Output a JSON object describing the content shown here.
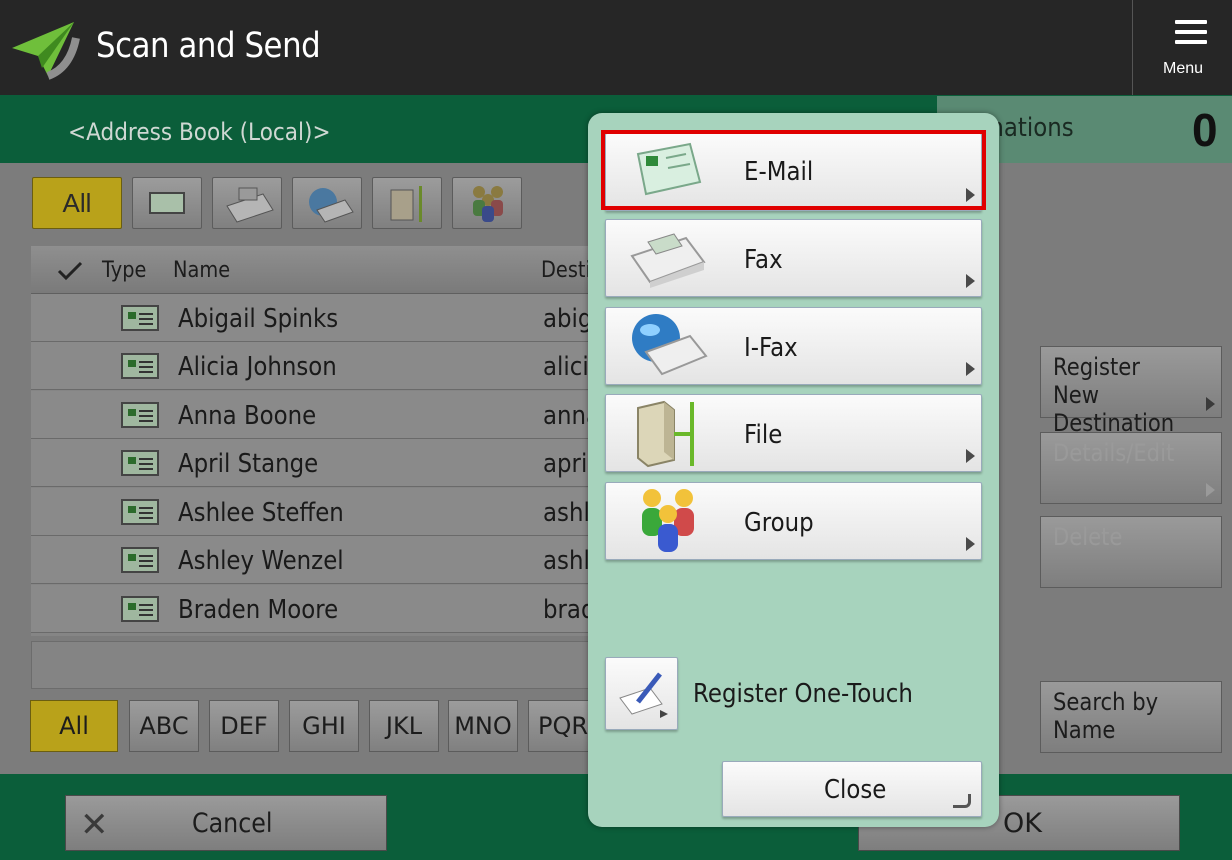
{
  "app": {
    "title": "Scan and Send",
    "menu_label": "Menu"
  },
  "address_book": {
    "title": "<Address Book (Local)>"
  },
  "destinations": {
    "label": "Destinations",
    "visible_label": "inations",
    "count": "0"
  },
  "filters": {
    "all_label": "All",
    "icons": [
      "email-icon",
      "fax-icon",
      "ifax-icon",
      "file-icon",
      "group-icon"
    ]
  },
  "table": {
    "headers": {
      "type": "Type",
      "name": "Name",
      "destination": "Desti"
    },
    "rows": [
      {
        "name": "Abigail Spinks",
        "destination": "abig"
      },
      {
        "name": "Alicia Johnson",
        "destination": "alicia"
      },
      {
        "name": "Anna Boone",
        "destination": "anna"
      },
      {
        "name": "April Stange",
        "destination": "april"
      },
      {
        "name": "Ashlee Steffen",
        "destination": "ashle"
      },
      {
        "name": "Ashley Wenzel",
        "destination": "ashle"
      },
      {
        "name": "Braden Moore",
        "destination": "brad"
      }
    ]
  },
  "alpha_tabs": [
    "All",
    "ABC",
    "DEF",
    "GHI",
    "JKL",
    "MNO",
    "PQR"
  ],
  "side_buttons": {
    "register_new_line1": "Register New",
    "register_new_line2": "Destination",
    "details_edit": "Details/Edit",
    "delete": "Delete",
    "search_line1": "Search by",
    "search_line2": "Name"
  },
  "footer": {
    "cancel_label": "Cancel",
    "ok_label": "OK"
  },
  "popup": {
    "items": [
      {
        "label": "E-Mail",
        "icon": "email-icon"
      },
      {
        "label": "Fax",
        "icon": "fax-icon"
      },
      {
        "label": "I-Fax",
        "icon": "ifax-icon"
      },
      {
        "label": "File",
        "icon": "file-icon"
      },
      {
        "label": "Group",
        "icon": "group-icon"
      }
    ],
    "register_one_touch": "Register One-Touch",
    "close_label": "Close"
  },
  "colors": {
    "highlight": "#e00000",
    "accent_green": "#0b5e3a",
    "popup_bg": "#a7d3bd",
    "selected_yellow": "#b9a21a"
  }
}
